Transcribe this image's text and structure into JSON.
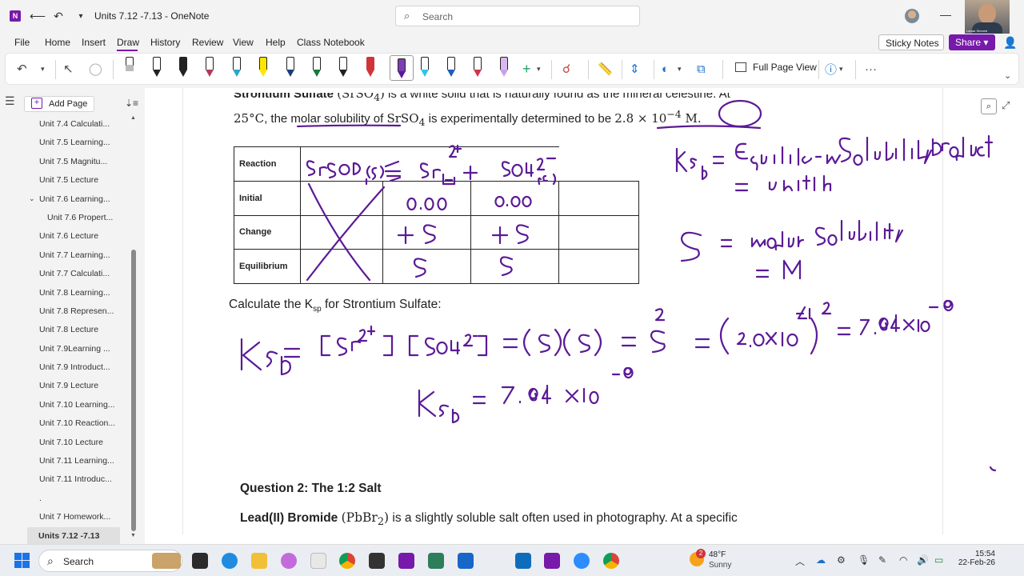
{
  "window": {
    "title": "Units 7.12 -7.13  -  OneNote",
    "search_placeholder": "Search"
  },
  "webcam": {
    "name": "Lamar Shrewd"
  },
  "menu": {
    "items": [
      "File",
      "Home",
      "Insert",
      "Draw",
      "History",
      "Review",
      "View",
      "Help",
      "Class Notebook"
    ],
    "sticky_notes": "Sticky Notes",
    "share": "Share"
  },
  "ribbon": {
    "full_page_view": "Full Page View"
  },
  "sidebar": {
    "add_page": "Add Page",
    "pages": [
      {
        "label": "Unit 7.4 Calculati...",
        "indent": 1
      },
      {
        "label": "Unit 7.5 Learning...",
        "indent": 1
      },
      {
        "label": "Unit 7.5 Magnitu...",
        "indent": 1
      },
      {
        "label": "Unit 7.5 Lecture",
        "indent": 1
      },
      {
        "label": "Unit 7.6 Learning...",
        "indent": 1,
        "expanded": true
      },
      {
        "label": "Unit 7.6 Propert...",
        "indent": 2
      },
      {
        "label": "Unit 7.6 Lecture",
        "indent": 1
      },
      {
        "label": "Unit 7.7 Learning...",
        "indent": 1
      },
      {
        "label": "Unit 7.7 Calculati...",
        "indent": 1
      },
      {
        "label": "Unit 7.8 Learning...",
        "indent": 1
      },
      {
        "label": "Unit 7.8 Represen...",
        "indent": 1
      },
      {
        "label": "Unit 7.8 Lecture",
        "indent": 1
      },
      {
        "label": "Unit 7.9Learning ...",
        "indent": 1
      },
      {
        "label": "Unit 7.9 Introduct...",
        "indent": 1
      },
      {
        "label": "Unit 7.9 Lecture",
        "indent": 1
      },
      {
        "label": "Unit 7.10 Learning...",
        "indent": 1
      },
      {
        "label": "Unit 7.10 Reaction...",
        "indent": 1
      },
      {
        "label": "Unit 7.10 Lecture",
        "indent": 1
      },
      {
        "label": "Unit 7.11 Learning...",
        "indent": 1
      },
      {
        "label": "Unit 7.11 Introduc...",
        "indent": 1
      },
      {
        "label": ".",
        "indent": 1
      },
      {
        "label": "Unit 7 Homework...",
        "indent": 1
      },
      {
        "label": "Units 7.12 -7.13",
        "indent": 1,
        "selected": true
      }
    ]
  },
  "page": {
    "intro_line1_bold": "Strontium Sulfate",
    "intro_line1_formula": "(SrSO",
    "intro_line1_sub": "4",
    "intro_line1_close": ")",
    "intro_line1_rest": " is a white solid that is naturally found as the mineral celestine. At",
    "intro_line2_temp": "25°C",
    "intro_line2_a": ", the molar solubility of ",
    "intro_line2_formula": "SrSO",
    "intro_line2_sub": "4",
    "intro_line2_b": " is experimentally determined to be ",
    "intro_line2_value": "2.8 × 10",
    "intro_line2_exp": "−4",
    "intro_line2_unit": " M.",
    "table_rows": [
      "Reaction",
      "Initial",
      "Change",
      "Equilibrium"
    ],
    "calc_prefix": "Calculate the K",
    "calc_sub": "sp",
    "calc_suffix": " for Strontium Sulfate:",
    "q2_heading": "Question 2: The 1:2 Salt",
    "q2_bold": "Lead(II) Bromide",
    "q2_formula": "(PbBr",
    "q2_sub": "2",
    "q2_close": ")",
    "q2_rest": " is a slightly soluble salt often used in photography. At a specific"
  },
  "taskbar": {
    "search": "Search",
    "weather_badge": "2",
    "temp": "48°F",
    "condition": "Sunny",
    "time": "15:54",
    "date": "22-Feb-26"
  }
}
